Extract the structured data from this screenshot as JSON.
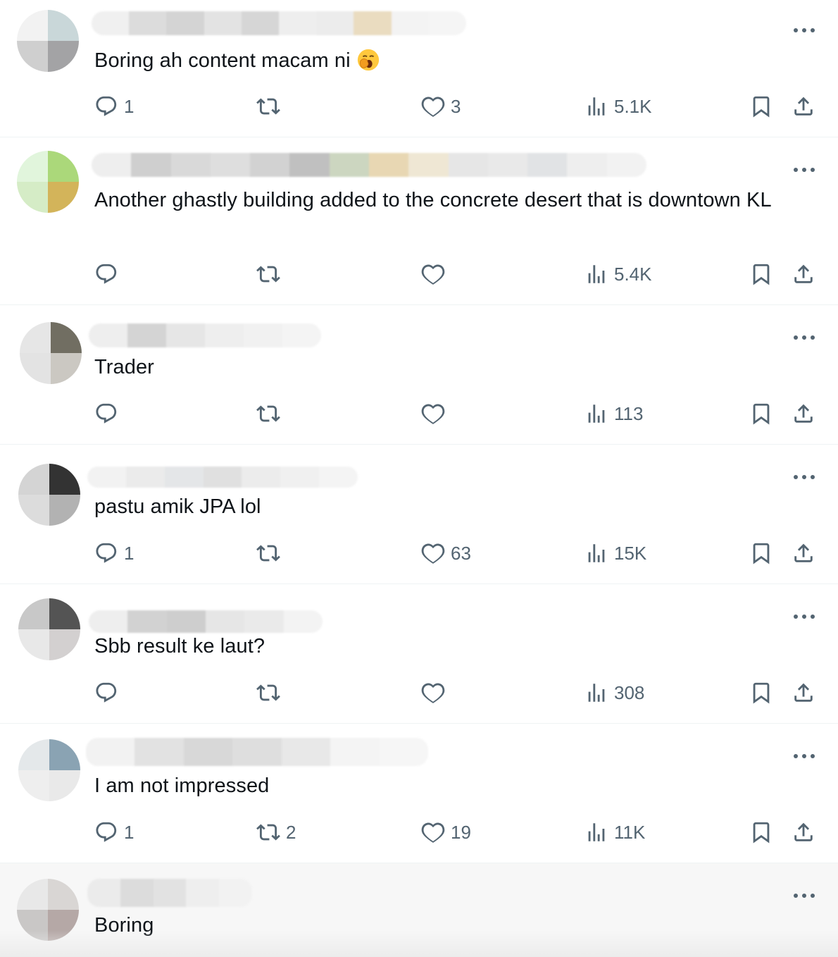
{
  "replies": [
    {
      "text": "Boring ah content macam ni",
      "has_emoji": true,
      "emoji_icon": "yawning-face-emoji",
      "reply_count": "1",
      "retweet_count": "",
      "like_count": "3",
      "views": "5.1K",
      "avatar_colors": [
        "#f2f2f2",
        "#c9d7d9",
        "#cfcfcf",
        "#a3a3a5"
      ],
      "name_colors": [
        "#f0f0f0",
        "#dcdcdc",
        "#d4d4d4",
        "#e3e3e3",
        "#d6d6d6",
        "#eeeeee",
        "#ececec",
        "#eadcc0",
        "#f3f3f3",
        "#f5f5f5"
      ]
    },
    {
      "text": "Another ghastly building added to the concrete desert that is downtown KL",
      "has_emoji": false,
      "reply_count": "",
      "retweet_count": "",
      "like_count": "",
      "views": "5.4K",
      "avatar_colors": [
        "#e1f5dc",
        "#abd87a",
        "#d5ecc6",
        "#d3b45a"
      ],
      "name_colors": [
        "#eeeeee",
        "#cfcfcf",
        "#d9d9d9",
        "#dedede",
        "#d2d2d2",
        "#c0c0c0",
        "#ccd6c0",
        "#e8d7b3",
        "#efe7d4",
        "#e6e6e6",
        "#e9e9e9",
        "#e1e3e5",
        "#eeeeee",
        "#f2f2f2"
      ]
    },
    {
      "text": "Trader",
      "has_emoji": false,
      "reply_count": "",
      "retweet_count": "",
      "like_count": "",
      "views": "113",
      "avatar_colors": [
        "#e6e6e6",
        "#716e62",
        "#e3e3e3",
        "#cbc8c2"
      ],
      "name_colors": [
        "#eeeeee",
        "#d4d4d4",
        "#e6e6e6",
        "#eeeeee",
        "#f1f1f1",
        "#f4f4f4"
      ]
    },
    {
      "text": "pastu amik JPA lol",
      "has_emoji": false,
      "reply_count": "1",
      "retweet_count": "",
      "like_count": "63",
      "views": "15K",
      "avatar_colors": [
        "#d4d4d4",
        "#333333",
        "#dcdcdc",
        "#b2b2b2"
      ],
      "name_colors": [
        "#f2f2f2",
        "#ebebeb",
        "#e4e6e8",
        "#e0e0e0",
        "#ececec",
        "#f0f0f0",
        "#f4f4f4"
      ]
    },
    {
      "text": "Sbb result ke laut?",
      "has_emoji": false,
      "reply_count": "",
      "retweet_count": "",
      "like_count": "",
      "views": "308",
      "avatar_colors": [
        "#c8c8c8",
        "#545454",
        "#e8e8e8",
        "#d3d0d0"
      ],
      "name_colors": [
        "#eeeeee",
        "#d2d2d2",
        "#cecece",
        "#e6e6e6",
        "#eaeaea",
        "#f3f3f3"
      ]
    },
    {
      "text": "I am not impressed",
      "has_emoji": false,
      "reply_count": "1",
      "retweet_count": "2",
      "like_count": "19",
      "views": "11K",
      "avatar_colors": [
        "#e4e8ea",
        "#8aa3b3",
        "#eeeeee",
        "#e9e9e9"
      ],
      "name_colors": [
        "#f2f2f2",
        "#e2e2e2",
        "#d8d8d8",
        "#dedede",
        "#e8e8e8",
        "#f4f4f4",
        "#f6f6f6"
      ]
    },
    {
      "text": "Boring",
      "has_emoji": false,
      "reply_count": "",
      "retweet_count": "",
      "like_count": "",
      "views": "",
      "avatar_colors": [
        "#e8e8e8",
        "#d9d6d4",
        "#c9c7c6",
        "#b5a8a6"
      ],
      "name_colors": [
        "#ebebeb",
        "#dcdcdc",
        "#e2e2e2",
        "#eeeeee",
        "#f2f2f2"
      ]
    }
  ]
}
